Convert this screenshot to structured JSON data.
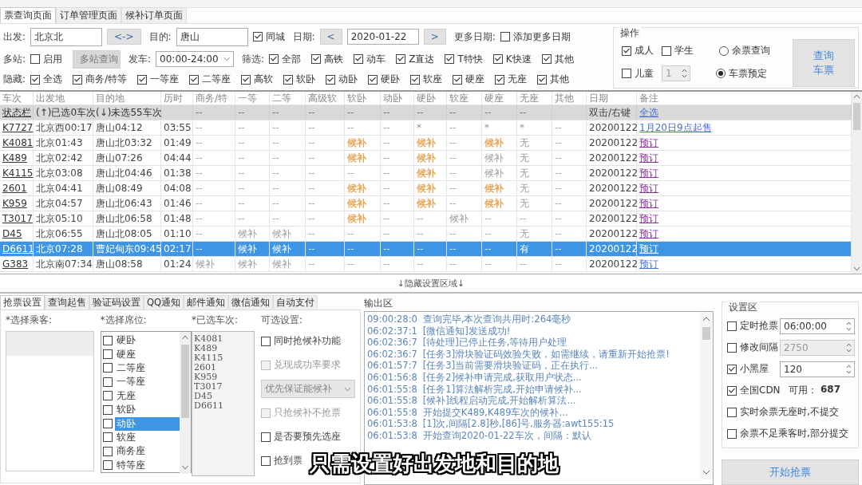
{
  "tabs": [
    {
      "label": "票查询页面",
      "selected": true
    },
    {
      "label": "订单管理页面",
      "selected": false
    },
    {
      "label": "候补订单页面",
      "selected": false
    }
  ],
  "query_form": {
    "rows": [
      {
        "items": [
          {
            "kind": "label",
            "text": "出发:"
          },
          {
            "kind": "field",
            "value": "北京北"
          },
          {
            "kind": "button",
            "label": "<->"
          },
          {
            "kind": "label",
            "text": "目的:"
          },
          {
            "kind": "field",
            "value": "唐山"
          },
          {
            "kind": "checkbox",
            "label": "同城",
            "checked": true
          },
          {
            "kind": "label",
            "text": "日期:"
          },
          {
            "kind": "button",
            "label": "<"
          },
          {
            "kind": "field",
            "value": "2020-01-22"
          },
          {
            "kind": "button",
            "label": ">"
          },
          {
            "kind": "label",
            "text": "更多日期:"
          },
          {
            "kind": "checkbox",
            "label": "添加更多日期",
            "checked": false
          }
        ]
      },
      {
        "items": [
          {
            "kind": "label",
            "text": "多站:"
          },
          {
            "kind": "checkbox",
            "label": "启用",
            "checked": false
          },
          {
            "kind": "button",
            "label": "多站查询",
            "disabled": true
          },
          {
            "kind": "label",
            "text": "发车:"
          },
          {
            "kind": "select",
            "value": "00:00-24:00"
          },
          {
            "kind": "label",
            "text": "筛选:"
          },
          {
            "kind": "checkbox",
            "label": "全部",
            "checked": true
          },
          {
            "kind": "checkbox",
            "label": "高铁",
            "checked": true
          },
          {
            "kind": "checkbox",
            "label": "动车",
            "checked": true
          },
          {
            "kind": "checkbox",
            "label": "Z直达",
            "checked": true
          },
          {
            "kind": "checkbox",
            "label": "T特快",
            "checked": true
          },
          {
            "kind": "checkbox",
            "label": "K快速",
            "checked": true
          },
          {
            "kind": "checkbox",
            "label": "其他",
            "checked": true
          }
        ]
      },
      {
        "items": [
          {
            "kind": "label",
            "text": "隐藏:"
          },
          {
            "kind": "checkbox",
            "label": "全选",
            "checked": true
          },
          {
            "kind": "checkbox",
            "label": "商务/特等",
            "checked": true
          },
          {
            "kind": "checkbox",
            "label": "一等座",
            "checked": true
          },
          {
            "kind": "checkbox",
            "label": "二等座",
            "checked": true
          },
          {
            "kind": "checkbox",
            "label": "高软",
            "checked": true
          },
          {
            "kind": "checkbox",
            "label": "软卧",
            "checked": true
          },
          {
            "kind": "checkbox",
            "label": "动卧",
            "checked": true
          },
          {
            "kind": "checkbox",
            "label": "硬卧",
            "checked": true
          },
          {
            "kind": "checkbox",
            "label": "软座",
            "checked": true
          },
          {
            "kind": "checkbox",
            "label": "硬座",
            "checked": true
          },
          {
            "kind": "checkbox",
            "label": "无座",
            "checked": true
          },
          {
            "kind": "checkbox",
            "label": "其他",
            "checked": true
          }
        ]
      }
    ]
  },
  "operation": {
    "title": "操作",
    "rows": [
      {
        "items": [
          {
            "kind": "checkbox",
            "label": "成人",
            "checked": true
          },
          {
            "kind": "checkbox",
            "label": "学生",
            "checked": false
          },
          {
            "kind": "radio",
            "label": "余票查询",
            "selected": false
          }
        ]
      },
      {
        "items": [
          {
            "kind": "checkbox",
            "label": "儿童",
            "checked": false
          },
          {
            "kind": "spinner",
            "value": "1",
            "disabled": true
          },
          {
            "kind": "radio",
            "label": "车票预定",
            "selected": true
          }
        ]
      }
    ],
    "button": "查询车票"
  },
  "table": {
    "columns": [
      "车次",
      "出发地",
      "目的地",
      "历时",
      "商务/特",
      "一等",
      "二等",
      "高级软",
      "软卧",
      "动卧",
      "硬卧",
      "软座",
      "硬座",
      "无座",
      "其他",
      "日期",
      "备注"
    ],
    "status_row": {
      "train": "状态栏",
      "from": "(↑)已选0车次",
      "to": "(↓)未选55车次",
      "seats": [
        "--",
        "--",
        "--",
        "--",
        "--",
        "--",
        "--",
        "--",
        "--",
        "--"
      ],
      "date": "双击/右键",
      "note": "全选"
    },
    "rows": [
      {
        "train": "K7727",
        "from": "北京西00:17",
        "to": "唐山04:12",
        "duration": "03:55",
        "seats": [
          "--",
          "--",
          "--",
          "--",
          "--",
          "--",
          "*",
          "--",
          "*",
          "*",
          "--"
        ],
        "date": "20200122",
        "note": "1月20日9点起售",
        "note_visited": false,
        "selected": false
      },
      {
        "train": "K4081",
        "from": "北京01:43",
        "to": "唐山北03:32",
        "duration": "01:49",
        "seats": [
          "--",
          "--",
          "--",
          "--",
          {
            "text": "候补",
            "color": "#e6a75a"
          },
          "--",
          {
            "text": "候补",
            "color": "#e6a75a"
          },
          "--",
          {
            "text": "候补",
            "color": "#e6a75a"
          },
          "无",
          "--"
        ],
        "date": "20200122",
        "note": "预订",
        "note_visited": true,
        "selected": false
      },
      {
        "train": "K489",
        "from": "北京02:42",
        "to": "唐山07:26",
        "duration": "04:44",
        "seats": [
          "--",
          "--",
          "--",
          "--",
          {
            "text": "候补",
            "color": "#e6a75a"
          },
          "--",
          {
            "text": "候补",
            "color": "#e6a75a"
          },
          "--",
          "候补",
          "无",
          "--"
        ],
        "date": "20200122",
        "note": "预订",
        "note_visited": true,
        "selected": false
      },
      {
        "train": "K4115",
        "from": "北京03:08",
        "to": "唐山北04:46",
        "duration": "01:38",
        "seats": [
          "--",
          "--",
          "--",
          "--",
          "--",
          "--",
          {
            "text": "候补",
            "color": "#e6a75a"
          },
          "--",
          "候补",
          "无",
          "--"
        ],
        "date": "20200122",
        "note": "预订",
        "note_visited": true,
        "selected": false
      },
      {
        "train": "2601",
        "from": "北京04:41",
        "to": "唐山08:49",
        "duration": "04:08",
        "seats": [
          "--",
          "--",
          "--",
          "--",
          {
            "text": "候补",
            "color": "#e6a75a"
          },
          "--",
          {
            "text": "候补",
            "color": "#e6a75a"
          },
          "--",
          {
            "text": "候补",
            "color": "#e6a75a"
          },
          "无",
          "--"
        ],
        "date": "20200122",
        "note": "预订",
        "note_visited": true,
        "selected": false
      },
      {
        "train": "K959",
        "from": "北京04:57",
        "to": "唐山北06:43",
        "duration": "01:46",
        "seats": [
          "--",
          "--",
          "--",
          "--",
          {
            "text": "候补",
            "color": "#e6a75a"
          },
          "--",
          {
            "text": "候补",
            "color": "#e6a75a"
          },
          "--",
          {
            "text": "候补",
            "color": "#e6a75a"
          },
          "无",
          "--"
        ],
        "date": "20200122",
        "note": "预订",
        "note_visited": true,
        "selected": false
      },
      {
        "train": "T3017",
        "from": "北京05:10",
        "to": "唐山北06:58",
        "duration": "01:48",
        "seats": [
          "--",
          "--",
          "--",
          "--",
          {
            "text": "候补",
            "color": "#e6a75a"
          },
          "--",
          "--",
          "候补",
          "--",
          "--",
          "--"
        ],
        "date": "20200122",
        "note": "预订",
        "note_visited": true,
        "selected": false
      },
      {
        "train": "D45",
        "from": "北京06:55",
        "to": "唐山北08:05",
        "duration": "01:10",
        "seats": [
          "--",
          "候补",
          "候补",
          "--",
          "--",
          "--",
          "--",
          "--",
          "--",
          "无",
          "--"
        ],
        "date": "20200122",
        "note": "预订",
        "note_visited": true,
        "selected": false
      },
      {
        "train": "D6611",
        "from": "北京07:28",
        "to": "曹妃甸东09:45",
        "duration": "02:17",
        "seats": [
          "--",
          "候补",
          "候补",
          "--",
          "--",
          "--",
          "--",
          "--",
          "--",
          "有",
          "--"
        ],
        "date": "20200122",
        "note": "预订",
        "note_visited": true,
        "selected": true
      },
      {
        "train": "G383",
        "from": "北京南07:34",
        "to": "唐山08:58",
        "duration": "01:24",
        "seats": [
          "候补",
          "候补",
          "候补",
          "--",
          "--",
          "--",
          "--",
          "--",
          "--",
          "--",
          "--"
        ],
        "date": "20200122",
        "note": "预订",
        "note_visited": false,
        "selected": false
      }
    ]
  },
  "hide_bar": "↓隐藏设置区域↓",
  "settings_tabs": [
    {
      "label": "抢票设置",
      "selected": true
    },
    {
      "label": "查询起售",
      "selected": false
    },
    {
      "label": "验证码设置",
      "selected": false
    },
    {
      "label": "QQ通知",
      "selected": false
    },
    {
      "label": "邮件通知",
      "selected": false
    },
    {
      "label": "微信通知",
      "selected": false
    },
    {
      "label": "自动支付",
      "selected": false
    }
  ],
  "passengers": {
    "title": "*选择乘客:"
  },
  "seat_list": {
    "title": "*选择席位:",
    "items": [
      {
        "label": "硬卧",
        "checked": false,
        "selected": false
      },
      {
        "label": "硬座",
        "checked": false,
        "selected": false
      },
      {
        "label": "二等座",
        "checked": false,
        "selected": false
      },
      {
        "label": "一等座",
        "checked": false,
        "selected": false
      },
      {
        "label": "无座",
        "checked": false,
        "selected": false
      },
      {
        "label": "软卧",
        "checked": false,
        "selected": false
      },
      {
        "label": "动卧",
        "checked": false,
        "selected": true
      },
      {
        "label": "软座",
        "checked": false,
        "selected": false
      },
      {
        "label": "商务座",
        "checked": false,
        "selected": false
      },
      {
        "label": "特等座",
        "checked": false,
        "selected": false
      }
    ]
  },
  "selected_trains": {
    "title": "*已选车次:",
    "items": [
      "K4081",
      "K489",
      "K4115",
      "2601",
      "K959",
      "T3017",
      "D45",
      "D6611"
    ]
  },
  "options": {
    "title": "可选设置:",
    "items": [
      {
        "kind": "checkbox",
        "label": "同时抢候补功能",
        "checked": false
      },
      {
        "kind": "checkbox",
        "label": "兑现成功率要求",
        "checked": false,
        "disabled": true
      },
      {
        "kind": "select",
        "value": "优先保证能候补",
        "disabled": true
      },
      {
        "kind": "checkbox",
        "label": "只抢候补不抢票",
        "checked": false,
        "disabled": true
      },
      {
        "kind": "checkbox",
        "label": "是否要预先选座",
        "checked": false
      },
      {
        "kind": "checkbox",
        "label": "抢到票",
        "checked": false
      }
    ]
  },
  "output": {
    "title": "输出区",
    "lines": [
      {
        "time": "09:00:28:0",
        "text": "查询完毕,本次查询共用时:264毫秒"
      },
      {
        "time": "06:02:37:1",
        "text": "[微信通知]发送成功!"
      },
      {
        "time": "06:02:36:7",
        "text": "[待处理]已停止任务,等待用户处理"
      },
      {
        "time": "06:02:36:7",
        "text": "[任务3]滑块验证码效验失败，如需继续，请重新开始抢票!"
      },
      {
        "time": "06:01:57:7",
        "text": "[任务3]当前需要滑块验证码，正在执行..."
      },
      {
        "time": "06:01:56:8",
        "text": "[任务2]候补申请完成,获取用户状态..."
      },
      {
        "time": "06:01:55:8",
        "text": "[任务1]算法解析完成,开始申请候补..."
      },
      {
        "time": "06:01:55:8",
        "text": "[候补]线程启动完成,开始解析算法..."
      },
      {
        "time": "06:01:55:8",
        "text": "开始提交K489,K489车次的候补..."
      },
      {
        "time": "06:01:53:8",
        "text": "[1]次,间隔[2.8]秒,[86]号,服务器:awt155:15"
      },
      {
        "time": "06:01:53:8",
        "text": "开始查询2020-01-22车次，间隔：默认"
      }
    ]
  },
  "settings": {
    "title": "设置区",
    "items": [
      {
        "kind": "checkbox",
        "label": "定时抢票",
        "checked": false,
        "spinner": {
          "value": "06:00:00",
          "disabled": false
        }
      },
      {
        "kind": "checkbox",
        "label": "修改间隔",
        "checked": false,
        "spinner": {
          "value": "2750",
          "disabled": true
        }
      },
      {
        "kind": "checkbox",
        "label": "小黑屋",
        "checked": true,
        "spinner": {
          "value": "120",
          "disabled": false
        }
      },
      {
        "kind": "checkbox",
        "label": "全国CDN",
        "checked": true,
        "info": "可用：",
        "count": "687"
      },
      {
        "kind": "checkbox",
        "label": "实时余票无座时,不提交",
        "checked": false
      },
      {
        "kind": "checkbox",
        "label": "余票不足乘客时,部分提交",
        "checked": false
      }
    ],
    "button": "开始抢票"
  },
  "subtitle": "只需设置好出发地和目的地"
}
